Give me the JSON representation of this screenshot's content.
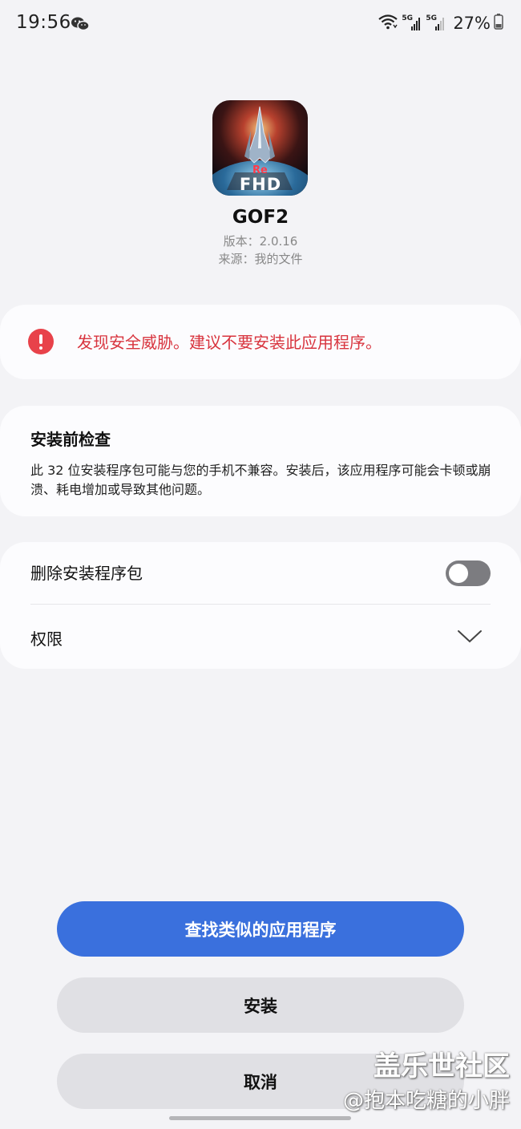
{
  "status_bar": {
    "time": "19:56",
    "network_1": "5G",
    "network_2": "5G",
    "battery": "27%",
    "icons": [
      "wechat-icon",
      "wifi-icon",
      "signal-icon",
      "signal-icon",
      "battery-icon"
    ]
  },
  "app": {
    "icon_name": "gof2-app-icon",
    "icon_text_top": "Re",
    "icon_text_main": "FHD",
    "name": "GOF2",
    "version": "版本：2.0.16",
    "source": "来源：我的文件"
  },
  "warning": {
    "icon": "warning-icon",
    "text": "发现安全威胁。建议不要安装此应用程序。",
    "color": "#d8343e"
  },
  "check": {
    "title": "安装前检查",
    "body": "此 32 位安装程序包可能与您的手机不兼容。安装后，该应用程序可能会卡顿或崩溃、耗电增加或导致其他问题。"
  },
  "options": {
    "delete_package_label": "删除安装程序包",
    "delete_package_enabled": false,
    "permissions_label": "权限"
  },
  "buttons": {
    "find_similar": "查找类似的应用程序",
    "install": "安装",
    "cancel": "取消"
  },
  "watermark": {
    "line1": "盖乐世社区",
    "line2": "@抱本吃糖的小胖"
  },
  "colors": {
    "accent": "#3a70dd",
    "background": "#f3f3f6",
    "card": "#fcfcfe",
    "warning": "#e8424a"
  }
}
